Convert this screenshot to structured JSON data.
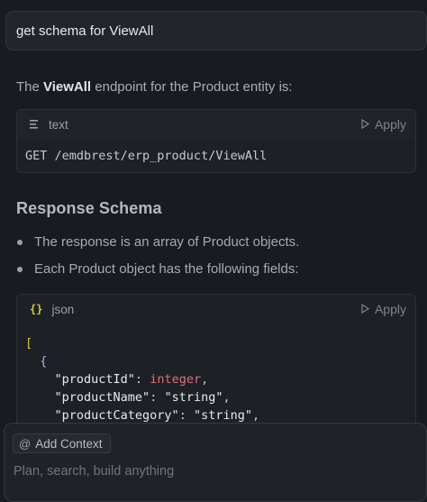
{
  "query": {
    "text": "get schema for ViewAll"
  },
  "intro": {
    "prefix": "The ",
    "bold": "ViewAll",
    "suffix": " endpoint for the Product entity is:"
  },
  "code_block_1": {
    "lang_label": "text",
    "apply_label": "Apply",
    "code": "GET /emdbrest/erp_product/ViewAll"
  },
  "section_title": "Response Schema",
  "bullets": [
    "The response is an array of Product objects.",
    "Each Product object has the following fields:"
  ],
  "code_block_2": {
    "lang_label": "json",
    "apply_label": "Apply",
    "lines": {
      "l1": "[",
      "l2": "{",
      "l3_key": "\"productId\"",
      "l3_sep": ": ",
      "l3_val": "integer",
      "l3_end": ",",
      "l4_key": "\"productName\"",
      "l4_sep": ": ",
      "l4_val": "\"string\"",
      "l4_end": ",",
      "l5_key": "\"productCategory\"",
      "l5_sep": ": ",
      "l5_val": "\"string\"",
      "l5_end": ","
    }
  },
  "composer": {
    "add_context_label": "Add Context",
    "placeholder": "Plan, search, build anything"
  },
  "colors": {
    "background": "#181b20",
    "keyword_type": "#e06f7c",
    "bracket": "#d9c64a"
  }
}
